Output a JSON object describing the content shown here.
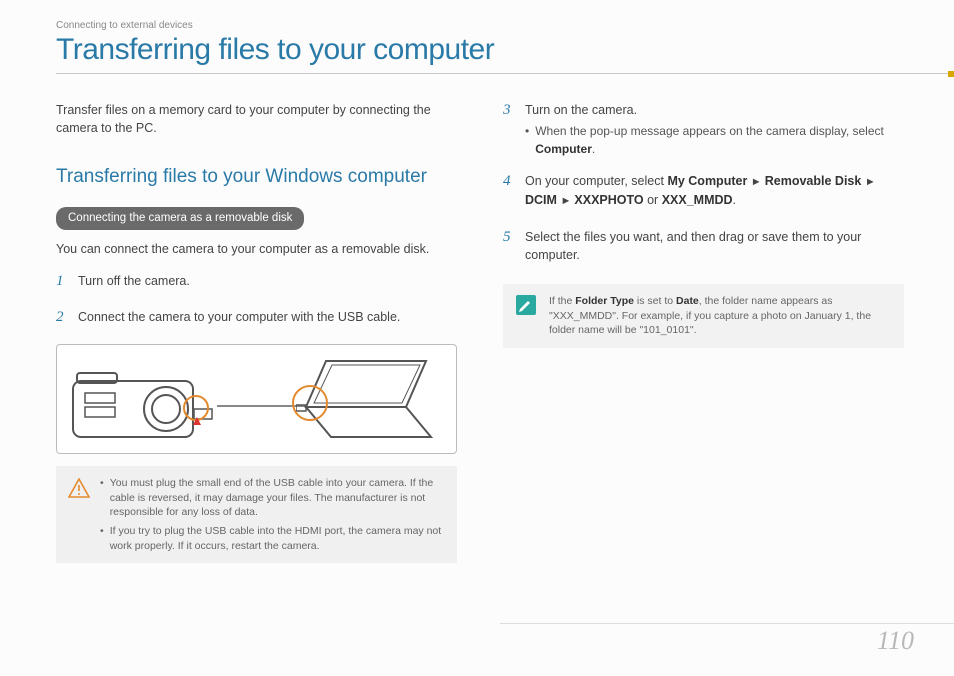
{
  "header": {
    "breadcrumb": "Connecting to external devices",
    "title": "Transferring files to your computer"
  },
  "left": {
    "intro": "Transfer files on a memory card to your computer by connecting the camera to the PC.",
    "h2": "Transferring files to your Windows computer",
    "pill": "Connecting the camera as a removable disk",
    "lead": "You can connect the camera to your computer as a removable disk.",
    "steps": {
      "s1": {
        "num": "1",
        "text": "Turn off the camera."
      },
      "s2": {
        "num": "2",
        "text": "Connect the camera to your computer with the USB cable."
      }
    },
    "warning": {
      "b1": "You must plug the small end of the USB cable into your camera. If the cable is reversed, it may damage your files. The manufacturer is not responsible for any loss of data.",
      "b2": "If you try to plug the USB cable into the HDMI port, the camera may not work properly. If it occurs, restart the camera."
    }
  },
  "right": {
    "s3": {
      "num": "3",
      "text": "Turn on the camera.",
      "sub_prefix": "When the pop-up message appears on the camera display, select ",
      "sub_bold": "Computer",
      "sub_suffix": "."
    },
    "s4": {
      "num": "4",
      "prefix": "On your computer, select ",
      "path1": "My Computer",
      "path2": "Removable Disk",
      "path3": "DCIM",
      "path4": "XXXPHOTO",
      "or": " or ",
      "path5": "XXX_MMDD",
      "suffix": "."
    },
    "s5": {
      "num": "5",
      "text": "Select the files you want, and then drag or save them to your computer."
    },
    "info": {
      "prefix": "If the ",
      "b1": "Folder Type",
      "mid1": " is set to ",
      "b2": "Date",
      "mid2": ", the folder name appears as \"XXX_MMDD\". For example, if you capture a photo on January 1, the folder name will be \"101_0101\"."
    }
  },
  "page_number": "110",
  "icons": {
    "warning": "warning-triangle-icon",
    "info": "pencil-note-icon"
  }
}
